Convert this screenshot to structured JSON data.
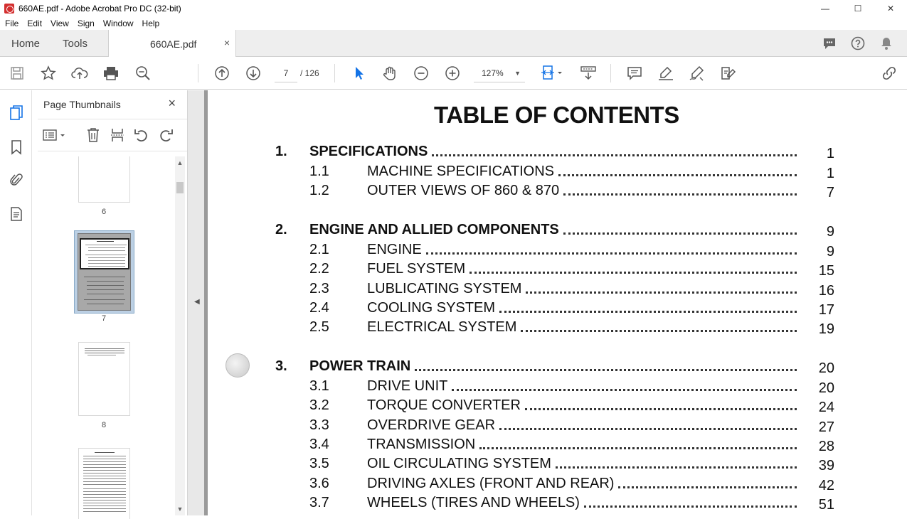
{
  "window": {
    "title": "660AE.pdf - Adobe Acrobat Pro DC (32-bit)",
    "minimize": "—",
    "maximize": "☐",
    "close": "✕"
  },
  "menu": [
    "File",
    "Edit",
    "View",
    "Sign",
    "Window",
    "Help"
  ],
  "tabs": {
    "home": "Home",
    "tools": "Tools",
    "document": "660AE.pdf",
    "close": "×"
  },
  "toolbar": {
    "page_current": "7",
    "page_total": "/ 126",
    "zoom": "127%"
  },
  "thumbnails": {
    "title": "Page Thumbnails",
    "close": "×",
    "pages": [
      "6",
      "7",
      "8"
    ]
  },
  "document": {
    "title": "TABLE OF CONTENTS",
    "sections": [
      {
        "num": "1.",
        "title": "SPECIFICATIONS",
        "page": "1",
        "subs": [
          {
            "num": "1.1",
            "title": "MACHINE SPECIFICATIONS",
            "page": "1"
          },
          {
            "num": "1.2",
            "title": "OUTER VIEWS OF 860 & 870",
            "page": "7"
          }
        ]
      },
      {
        "num": "2.",
        "title": "ENGINE AND ALLIED COMPONENTS",
        "page": "9",
        "subs": [
          {
            "num": "2.1",
            "title": "ENGINE",
            "page": "9"
          },
          {
            "num": "2.2",
            "title": "FUEL SYSTEM",
            "page": "15"
          },
          {
            "num": "2.3",
            "title": "LUBLICATING SYSTEM",
            "page": "16"
          },
          {
            "num": "2.4",
            "title": "COOLING SYSTEM",
            "page": "17"
          },
          {
            "num": "2.5",
            "title": "ELECTRICAL SYSTEM",
            "page": "19"
          }
        ]
      },
      {
        "num": "3.",
        "title": "POWER TRAIN",
        "page": "20",
        "subs": [
          {
            "num": "3.1",
            "title": "DRIVE UNIT",
            "page": "20"
          },
          {
            "num": "3.2",
            "title": "TORQUE CONVERTER",
            "page": "24"
          },
          {
            "num": "3.3",
            "title": "OVERDRIVE GEAR",
            "page": "27"
          },
          {
            "num": "3.4",
            "title": "TRANSMISSION",
            "page": "28"
          },
          {
            "num": "3.5",
            "title": "OIL CIRCULATING SYSTEM",
            "page": "39"
          },
          {
            "num": "3.6",
            "title": "DRIVING AXLES (FRONT AND REAR)",
            "page": "42"
          },
          {
            "num": "3.7",
            "title": "WHEELS (TIRES AND WHEELS)",
            "page": "51"
          }
        ]
      }
    ]
  }
}
